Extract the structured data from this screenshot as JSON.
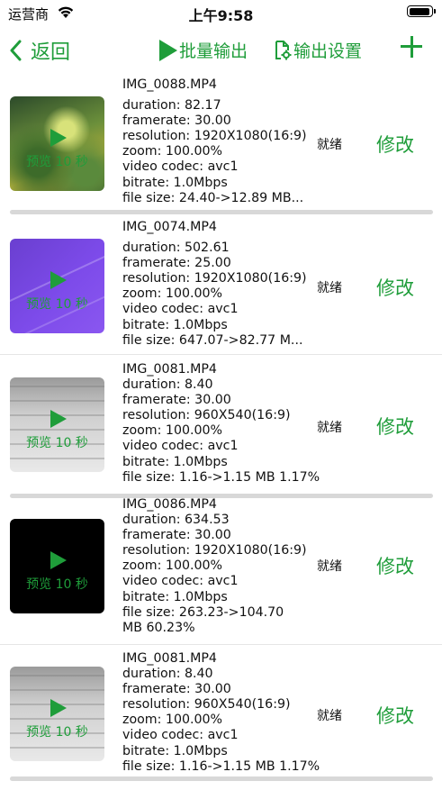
{
  "status": {
    "carrier": "运营商",
    "time": "上午9:58",
    "battery_level": 0.95
  },
  "nav": {
    "back_label": "返回",
    "batch_label": "批量输出",
    "settings_label": "输出设置",
    "add_icon": "plus-icon",
    "accent_color": "#1f9d3a"
  },
  "items": [
    {
      "filename": "IMG_0088.MP4",
      "duration": "duration: 82.17",
      "framerate": "framerate: 30.00",
      "resolution": "resolution: 1920X1080(16:9)",
      "zoom": "zoom: 100.00%",
      "codec": "video codec: avc1",
      "bitrate": "bitrate: 1.0Mbps",
      "filesize": "file size: 24.40->12.89 MB...",
      "preview": "预览 10 秒",
      "state": "就绪",
      "edit": "修改"
    },
    {
      "filename": "IMG_0074.MP4",
      "duration": "duration: 502.61",
      "framerate": "framerate: 25.00",
      "resolution": "resolution: 1920X1080(16:9)",
      "zoom": "zoom: 100.00%",
      "codec": "video codec: avc1",
      "bitrate": "bitrate: 1.0Mbps",
      "filesize": "file size: 647.07->82.77 M...",
      "preview": "预览 10 秒",
      "state": "就绪",
      "edit": "修改"
    },
    {
      "filename": "IMG_0081.MP4",
      "duration": "duration: 8.40",
      "framerate": "framerate: 30.00",
      "resolution": "resolution: 960X540(16:9)",
      "zoom": "zoom: 100.00%",
      "codec": "video codec: avc1",
      "bitrate": "bitrate: 1.0Mbps",
      "filesize": "file size: 1.16->1.15 MB 1.17%",
      "preview": "预览 10 秒",
      "state": "就绪",
      "edit": "修改"
    },
    {
      "filename": "IMG_0086.MP4",
      "duration": "duration: 634.53",
      "framerate": "framerate: 30.00",
      "resolution": "resolution: 1920X1080(16:9)",
      "zoom": "zoom: 100.00%",
      "codec": "video codec: avc1",
      "bitrate": "bitrate: 1.0Mbps",
      "filesize": "file size: 263.23->104.70 MB 60.23%",
      "preview": "预览 10 秒",
      "state": "就绪",
      "edit": "修改"
    },
    {
      "filename": "IMG_0081.MP4",
      "duration": "duration: 8.40",
      "framerate": "framerate: 30.00",
      "resolution": "resolution: 960X540(16:9)",
      "zoom": "zoom: 100.00%",
      "codec": "video codec: avc1",
      "bitrate": "bitrate: 1.0Mbps",
      "filesize": "file size: 1.16->1.15 MB 1.17%",
      "preview": "预览 10 秒",
      "state": "就绪",
      "edit": "修改"
    }
  ]
}
